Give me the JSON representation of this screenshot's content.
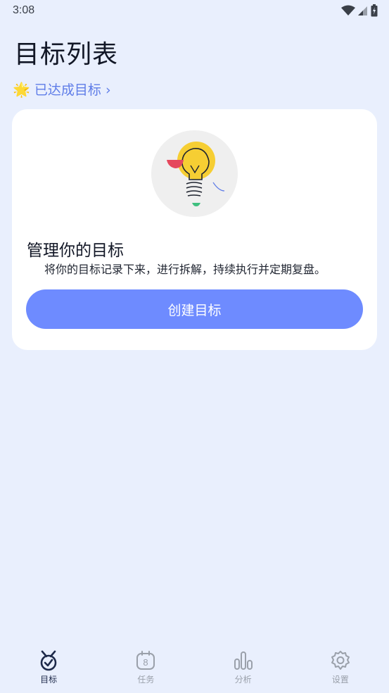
{
  "status_bar": {
    "time": "3:08",
    "icons": [
      "wifi-icon",
      "signal-icon",
      "battery-icon"
    ]
  },
  "header": {
    "title": "目标列表",
    "achieved_link": {
      "icon": "star-icon",
      "label": "已达成目标 ›"
    }
  },
  "card": {
    "illustration": "lightbulb-illustration",
    "title": "管理你的目标",
    "description": "将你的目标记录下来，进行拆解，持续执行并定期复盘。",
    "button_label": "创建目标"
  },
  "bottom_nav": {
    "items": [
      {
        "label": "目标",
        "icon": "medal-check-icon",
        "active": true
      },
      {
        "label": "任务",
        "icon": "calendar-icon",
        "badge": "8",
        "active": false
      },
      {
        "label": "分析",
        "icon": "bar-chart-icon",
        "active": false
      },
      {
        "label": "设置",
        "icon": "gear-icon",
        "active": false
      }
    ]
  },
  "colors": {
    "background": "#e9effd",
    "accent": "#6e8bff",
    "link": "#5f7de8",
    "card": "#ffffff"
  }
}
